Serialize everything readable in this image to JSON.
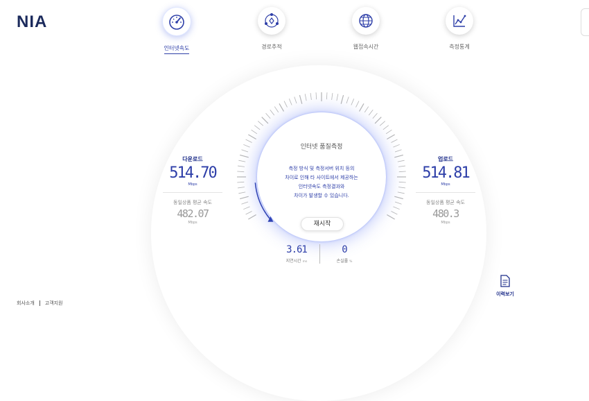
{
  "logo": "NIA",
  "nav": {
    "items": [
      {
        "label": "인터넷속도",
        "icon": "speedometer-icon",
        "active": true
      },
      {
        "label": "경로추적",
        "icon": "route-trace-icon",
        "active": false
      },
      {
        "label": "웹접속시간",
        "icon": "globe-icon",
        "active": false
      },
      {
        "label": "측정통계",
        "icon": "statistics-icon",
        "active": false
      }
    ]
  },
  "gauge": {
    "title": "인터넷 품질측정",
    "description": [
      "측정 방식 및 측정서버 위치 등의",
      "차이로 인해 타 사이트에서 제공하는",
      "인터넷속도 측정결과와",
      "차이가 발생할 수 있습니다."
    ],
    "restart_label": "재시작"
  },
  "download": {
    "label": "다운로드",
    "value": "514.70",
    "unit": "Mbps",
    "avg_label": "동일상품 평균 속도",
    "avg_value": "482.07",
    "avg_unit": "Mbps"
  },
  "upload": {
    "label": "업로드",
    "value": "514.81",
    "unit": "Mbps",
    "avg_label": "동일상품 평균 속도",
    "avg_value": "480.3",
    "avg_unit": "Mbps"
  },
  "latency": {
    "value": "3.61",
    "label": "지연시간",
    "unit": "ms"
  },
  "loss": {
    "value": "0",
    "label": "손실률",
    "unit": "%"
  },
  "history_label": "이력보기",
  "footer": {
    "about": "회사소개",
    "support": "고객지원"
  },
  "colors": {
    "accent": "#2d3ea8",
    "navy": "#1b2a5c",
    "glow": "#4a64f0"
  }
}
